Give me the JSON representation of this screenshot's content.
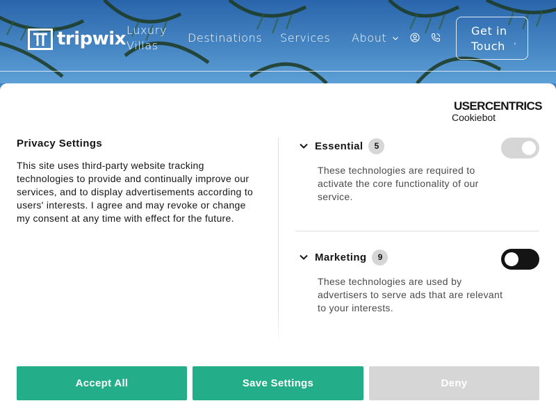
{
  "colors": {
    "accent": "#24ad89",
    "toggle_off": "#141414",
    "toggle_disabled": "#d6d6d6",
    "deny_bg": "#d6d6d6"
  },
  "nav": {
    "logo_text": "tripwix",
    "links": [
      {
        "label": "Luxury Villas"
      },
      {
        "label": "Destinations"
      },
      {
        "label": "Services"
      },
      {
        "label": "About"
      }
    ],
    "icons": [
      "user-icon",
      "phone-icon",
      "chevron-down-icon"
    ],
    "cta_label": "Get in Touch"
  },
  "consent": {
    "brand": {
      "name": "USERCENTRICS",
      "sub": "Cookiebot"
    },
    "title": "Privacy Settings",
    "text": "This site uses third-party website tracking technologies to provide and continually improve our services, and to display advertisements according to users' interests. I agree and may revoke or change my consent at any time with effect for the future.",
    "categories": [
      {
        "label": "Essential",
        "count": "5",
        "description": "These technologies are required to activate the core functionality of our service.",
        "toggle": "on-disabled"
      },
      {
        "label": "Marketing",
        "count": "9",
        "description": "These technologies are used by advertisers to serve ads that are relevant to your interests.",
        "toggle": "off"
      }
    ],
    "buttons": {
      "accept": "Accept All",
      "save": "Save Settings",
      "deny": "Deny"
    }
  }
}
